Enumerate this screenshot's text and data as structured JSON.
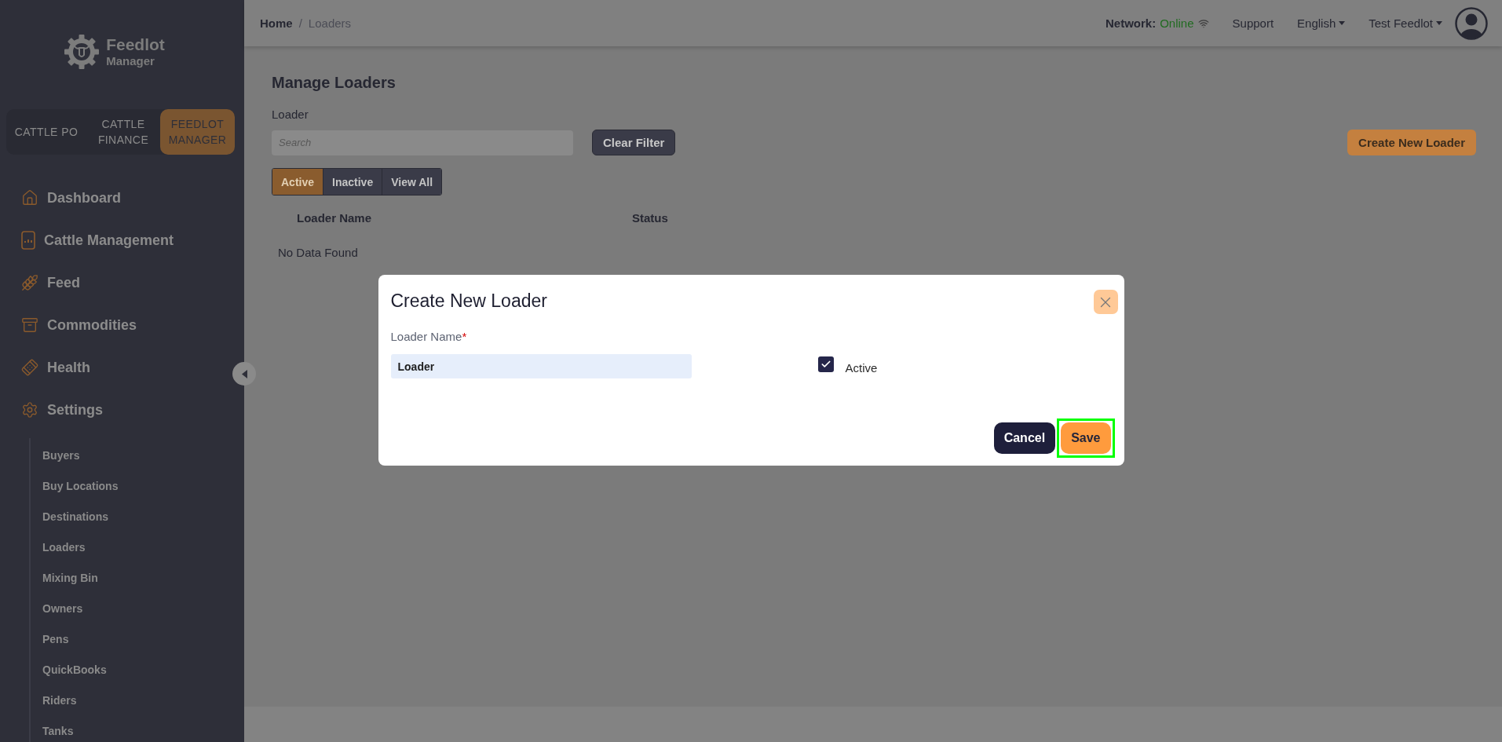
{
  "sidebar": {
    "logo": {
      "title": "Feedlot",
      "subtitle": "Manager"
    },
    "apps": [
      {
        "label": "CATTLE PO",
        "selected": false
      },
      {
        "label": "CATTLE FINANCE",
        "selected": false
      },
      {
        "label": "FEEDLOT MANAGER",
        "selected": true
      }
    ],
    "nav": [
      {
        "label": "Dashboard"
      },
      {
        "label": "Cattle Management"
      },
      {
        "label": "Feed"
      },
      {
        "label": "Commodities"
      },
      {
        "label": "Health"
      },
      {
        "label": "Settings",
        "expanded": true,
        "children": [
          {
            "label": "Buyers"
          },
          {
            "label": "Buy Locations"
          },
          {
            "label": "Destinations"
          },
          {
            "label": "Loaders"
          },
          {
            "label": "Mixing Bin"
          },
          {
            "label": "Owners"
          },
          {
            "label": "Pens"
          },
          {
            "label": "QuickBooks"
          },
          {
            "label": "Riders"
          },
          {
            "label": "Tanks"
          }
        ]
      }
    ]
  },
  "header": {
    "breadcrumb": [
      {
        "label": "Home"
      },
      {
        "label": "Loaders"
      }
    ],
    "separator": "/",
    "network": {
      "label": "Network:",
      "status": "Online"
    },
    "links": [
      {
        "label": "Support",
        "kind": "link"
      },
      {
        "label": "English",
        "kind": "dropdown"
      },
      {
        "label": "Test Feedlot",
        "kind": "dropdown"
      }
    ]
  },
  "page": {
    "title": "Manage Loaders",
    "filter_label": "Loader",
    "search": {
      "placeholder": "Search"
    },
    "clear_button": "Clear Filter",
    "create_button": "Create New Loader",
    "tabs": [
      {
        "label": "Active",
        "selected": true
      },
      {
        "label": "Inactive",
        "selected": false
      },
      {
        "label": "View All",
        "selected": false
      }
    ],
    "table": {
      "columns": [
        "Loader Name",
        "Status"
      ],
      "empty_message": "No Data Found"
    }
  },
  "modal": {
    "title": "Create New Loader",
    "field": {
      "label": "Loader Name",
      "required_mark": "*",
      "value": "Loader"
    },
    "checkbox": {
      "label": "Active",
      "checked": true
    },
    "buttons": [
      {
        "label": "Cancel",
        "kind": "secondary",
        "highlighted": false
      },
      {
        "label": "Save",
        "kind": "primary",
        "highlighted": true
      }
    ]
  }
}
